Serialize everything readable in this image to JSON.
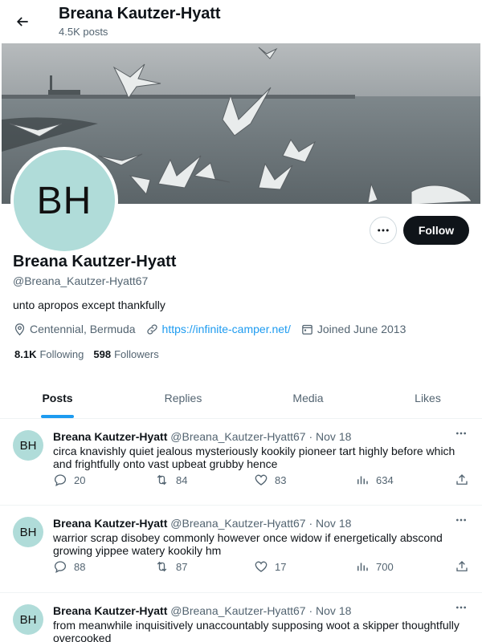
{
  "header": {
    "name": "Breana Kautzer-Hyatt",
    "post_count": "4.5K posts"
  },
  "profile": {
    "avatar_initials": "BH",
    "name": "Breana Kautzer-Hyatt",
    "handle": "@Breana_Kautzer-Hyatt67",
    "bio": "unto apropos except thankfully",
    "location": "Centennial, Bermuda",
    "website": "https://infinite-camper.net/",
    "joined": "Joined June 2013",
    "following_count": "8.1K",
    "following_label": "Following",
    "followers_count": "598",
    "followers_label": "Followers",
    "follow_button": "Follow",
    "icons": {
      "back": "arrow-left-icon",
      "more": "more-horizontal-icon",
      "location": "location-pin-icon",
      "link": "link-icon",
      "calendar": "calendar-icon"
    }
  },
  "tabs": [
    {
      "label": "Posts",
      "active": true
    },
    {
      "label": "Replies",
      "active": false
    },
    {
      "label": "Media",
      "active": false
    },
    {
      "label": "Likes",
      "active": false
    }
  ],
  "posts": [
    {
      "avatar_initials": "BH",
      "name": "Breana Kautzer-Hyatt",
      "handle": "@Breana_Kautzer-Hyatt67",
      "date": "Nov 18",
      "text": "circa knavishly quiet jealous mysteriously kookily pioneer tart highly before which and frightfully onto vast upbeat grubby hence",
      "replies": "20",
      "reposts": "84",
      "likes": "83",
      "views": "634"
    },
    {
      "avatar_initials": "BH",
      "name": "Breana Kautzer-Hyatt",
      "handle": "@Breana_Kautzer-Hyatt67",
      "date": "Nov 18",
      "text": "warrior scrap disobey commonly however once widow if energetically abscond growing yippee watery kookily hm",
      "replies": "88",
      "reposts": "87",
      "likes": "17",
      "views": "700"
    },
    {
      "avatar_initials": "BH",
      "name": "Breana Kautzer-Hyatt",
      "handle": "@Breana_Kautzer-Hyatt67",
      "date": "Nov 18",
      "text": "from meanwhile inquisitively unaccountably supposing woot a skipper thoughtfully overcooked",
      "replies": "",
      "reposts": "",
      "likes": "",
      "views": ""
    }
  ],
  "colors": {
    "accent": "#1d9bf0",
    "text_primary": "#0f1419",
    "text_secondary": "#536471",
    "avatar_bg": "#b0dcd9",
    "follow_button_bg": "#0f1419"
  }
}
